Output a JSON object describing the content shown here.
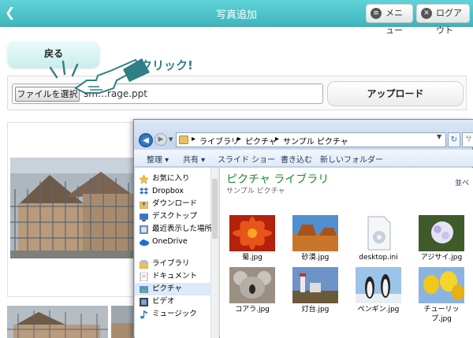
{
  "header": {
    "back_icon": "left-arrow-icon",
    "title": "写真追加",
    "menu_label": "メニュー",
    "logout_label": "ログアウト"
  },
  "back_button": {
    "label": "戻る"
  },
  "upload": {
    "choose_label": "ファイルを選択",
    "filename": "sm…rage.ppt",
    "upload_label": "アップロード"
  },
  "annotation": {
    "click_label": "クリック!"
  },
  "explorer": {
    "breadcrumbs": [
      "ライブラリ",
      "ピクチャ",
      "サンプル ピクチャ"
    ],
    "search_placeholder": "サ",
    "toolbar": [
      "整理 ▾",
      "共有 ▾",
      "スライド ショー",
      "書き込む",
      "新しいフォルダー"
    ],
    "nav": [
      {
        "label": "お気に入り",
        "icon": "star-icon"
      },
      {
        "label": "Dropbox",
        "icon": "dropbox-icon"
      },
      {
        "label": "ダウンロード",
        "icon": "download-folder-icon"
      },
      {
        "label": "デスクトップ",
        "icon": "desktop-icon"
      },
      {
        "label": "最近表示した場所",
        "icon": "recent-places-icon"
      },
      {
        "label": "OneDrive",
        "icon": "onedrive-icon"
      },
      {
        "label": "ライブラリ",
        "icon": "library-icon"
      },
      {
        "label": "ドキュメント",
        "icon": "documents-icon"
      },
      {
        "label": "ピクチャ",
        "icon": "pictures-icon",
        "selected": true
      },
      {
        "label": "ビデオ",
        "icon": "video-icon"
      },
      {
        "label": "ミュージック",
        "icon": "music-icon"
      }
    ],
    "library_title": "ピクチャ ライブラリ",
    "library_sub": "サンプル ピクチャ",
    "arrange_label": "並べ",
    "files": [
      "菊.jpg",
      "砂漠.jpg",
      "desktop.ini",
      "アジサイ.jpg",
      "コアラ.jpg",
      "灯台.jpg",
      "ペンギン.jpg",
      "チューリップ.jpg"
    ]
  },
  "colors": {
    "header": "#3fb5bd",
    "click_label": "#2f7f86",
    "library_title": "#1d8a2e"
  }
}
